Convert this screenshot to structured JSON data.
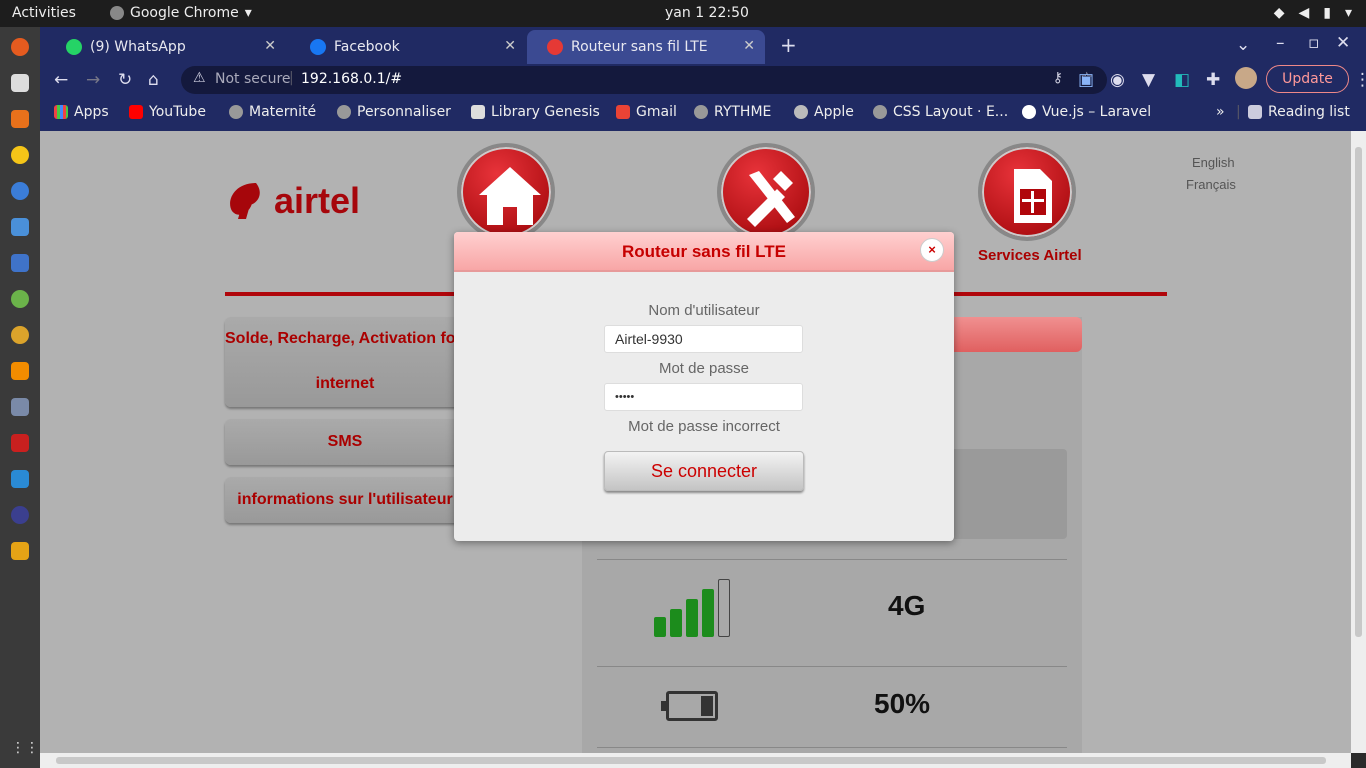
{
  "system": {
    "activities": "Activities",
    "app_name": "Google Chrome",
    "clock": "yan 1  22:50"
  },
  "tabs": [
    {
      "label": "(9) WhatsApp",
      "color": "#25d366"
    },
    {
      "label": "Facebook",
      "color": "#1877f2"
    },
    {
      "label": "Routeur sans fil LTE",
      "color": "#e53935"
    }
  ],
  "omnibox": {
    "security": "Not secure",
    "url": "192.168.0.1/#"
  },
  "update_label": "Update",
  "bookmarks": [
    "Apps",
    "YouTube",
    "Maternité",
    "Personnaliser",
    "Library Genesis",
    "Gmail",
    "RYTHME",
    "Apple",
    "CSS Layout · E...",
    "Vue.js – Laravel"
  ],
  "reading_list": "Reading list",
  "site": {
    "logo_text": "airtel",
    "services_label": "Services Airtel",
    "languages": [
      "English",
      "Français"
    ],
    "menu": [
      {
        "label": "Solde, Recharge, Activation forf",
        "label2": "internet"
      },
      {
        "label": "SMS"
      },
      {
        "label": "informations sur l'utilisateur"
      }
    ],
    "network_type": "4G",
    "signal_bars": 4,
    "battery_percent": "50%"
  },
  "modal": {
    "title": "Routeur sans fil LTE",
    "close": "×",
    "username_label": "Nom d'utilisateur",
    "username_value": "Airtel-9930",
    "password_label": "Mot de passe",
    "password_value": "•••••",
    "error": "Mot de passe incorrect",
    "submit": "Se connecter"
  }
}
